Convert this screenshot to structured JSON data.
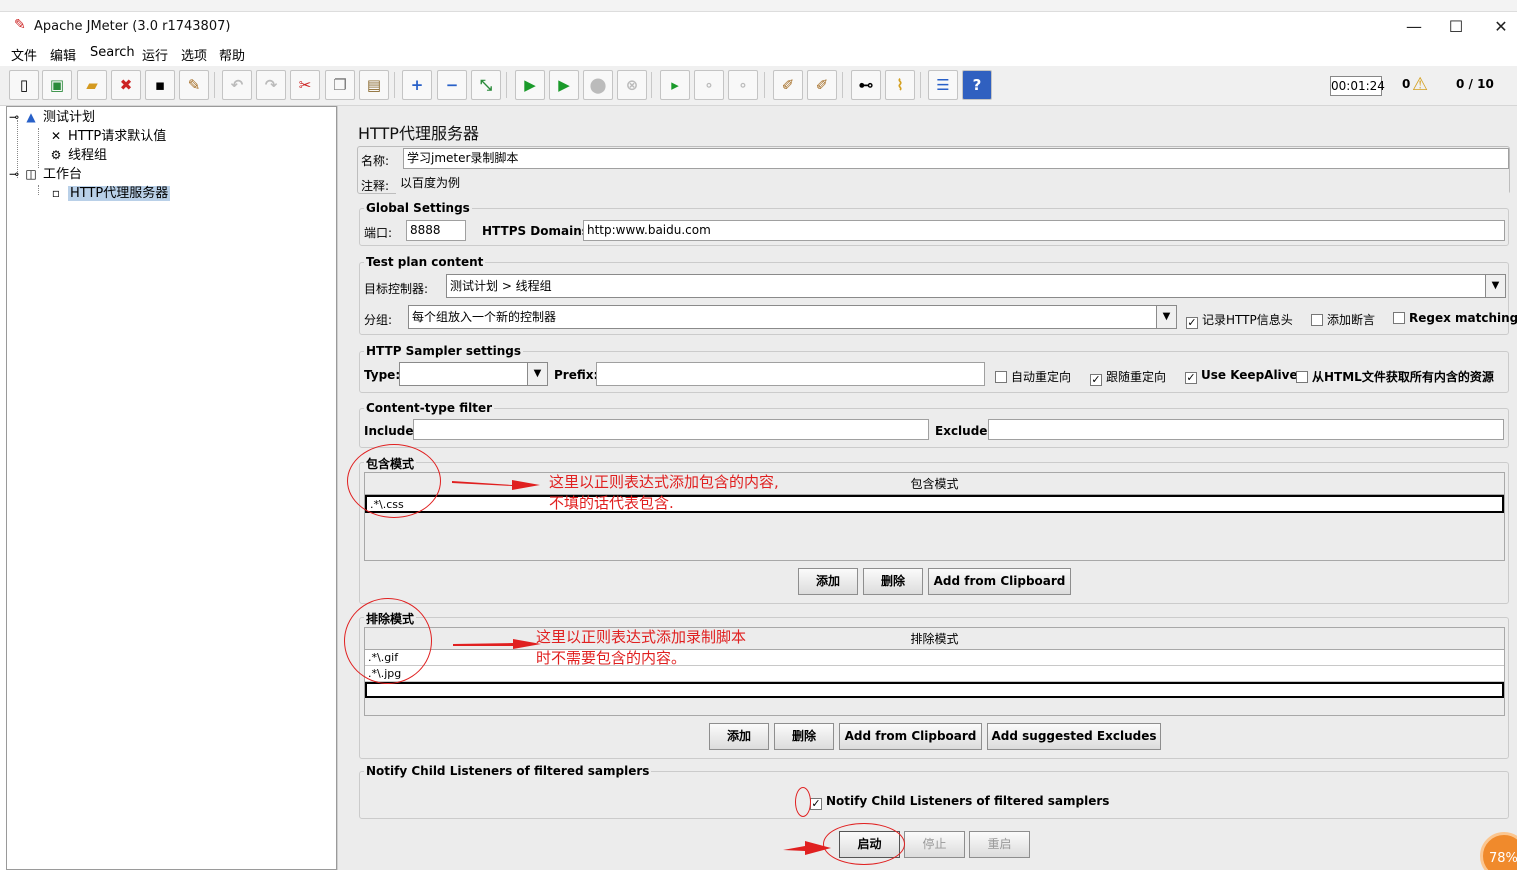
{
  "window": {
    "title": "Apache JMeter (3.0 r1743807)",
    "controls": [
      "—",
      "☐",
      "✕"
    ]
  },
  "menu": [
    "文件",
    "编辑",
    "Search",
    "运行",
    "选项",
    "帮助"
  ],
  "status": {
    "timer": "00:01:24",
    "warnings": "0",
    "threads": "0 / 10"
  },
  "tree": [
    "测试计划",
    "HTTP请求默认值",
    "线程组",
    "工作台",
    "HTTP代理服务器"
  ],
  "panel": {
    "title": "HTTP代理服务器",
    "name_label": "名称:",
    "name_value": "学习jmeter录制脚本",
    "comment_label": "注释:",
    "comment_value": "以百度为例",
    "global": {
      "title": "Global Settings",
      "port_label": "端口:",
      "port_value": "8888",
      "https_label": "HTTPS Domains :",
      "https_value": "http:www.baidu.com"
    },
    "testplan": {
      "title": "Test plan content",
      "target_label": "目标控制器:",
      "target_value": "测试计划 > 线程组",
      "group_label": "分组:",
      "group_value": "每个组放入一个新的控制器",
      "chk_headers": "记录HTTP信息头",
      "chk_assert": "添加断言",
      "chk_regex": "Regex matching"
    },
    "sampler": {
      "title": "HTTP Sampler settings",
      "type_label": "Type:",
      "prefix_label": "Prefix:",
      "chk_redirect": "自动重定向",
      "chk_follow": "跟随重定向",
      "chk_keepalive": "Use KeepAlive",
      "chk_fetch": "从HTML文件获取所有内含的资源"
    },
    "ctype": {
      "title": "Content-type filter",
      "include_label": "Include:",
      "exclude_label": "Exclude:"
    },
    "include": {
      "title": "包含模式",
      "column": "包含模式",
      "rows": [
        ".*\\.css"
      ],
      "btn_add": "添加",
      "btn_delete": "删除",
      "btn_clip": "Add from Clipboard"
    },
    "exclude": {
      "title": "排除模式",
      "column": "排除模式",
      "rows": [
        ".*\\.gif",
        ".*\\.jpg"
      ],
      "btn_add": "添加",
      "btn_delete": "删除",
      "btn_clip": "Add from Clipboard",
      "btn_suggest": "Add suggested Excludes"
    },
    "notify": {
      "title": "Notify Child Listeners of filtered samplers",
      "checkbox": "Notify Child Listeners of filtered samplers"
    },
    "actions": {
      "start": "启动",
      "stop": "停止",
      "restart": "重启"
    }
  },
  "annotations": {
    "include_note_1": "这里以正则表达式添加包含的内容,",
    "include_note_2": "不填的话代表包含.",
    "exclude_note_1": "这里以正则表达式添加录制脚本",
    "exclude_note_2": "时不需要包含的内容。"
  },
  "badge": "78%",
  "accent_color": "#e02020"
}
